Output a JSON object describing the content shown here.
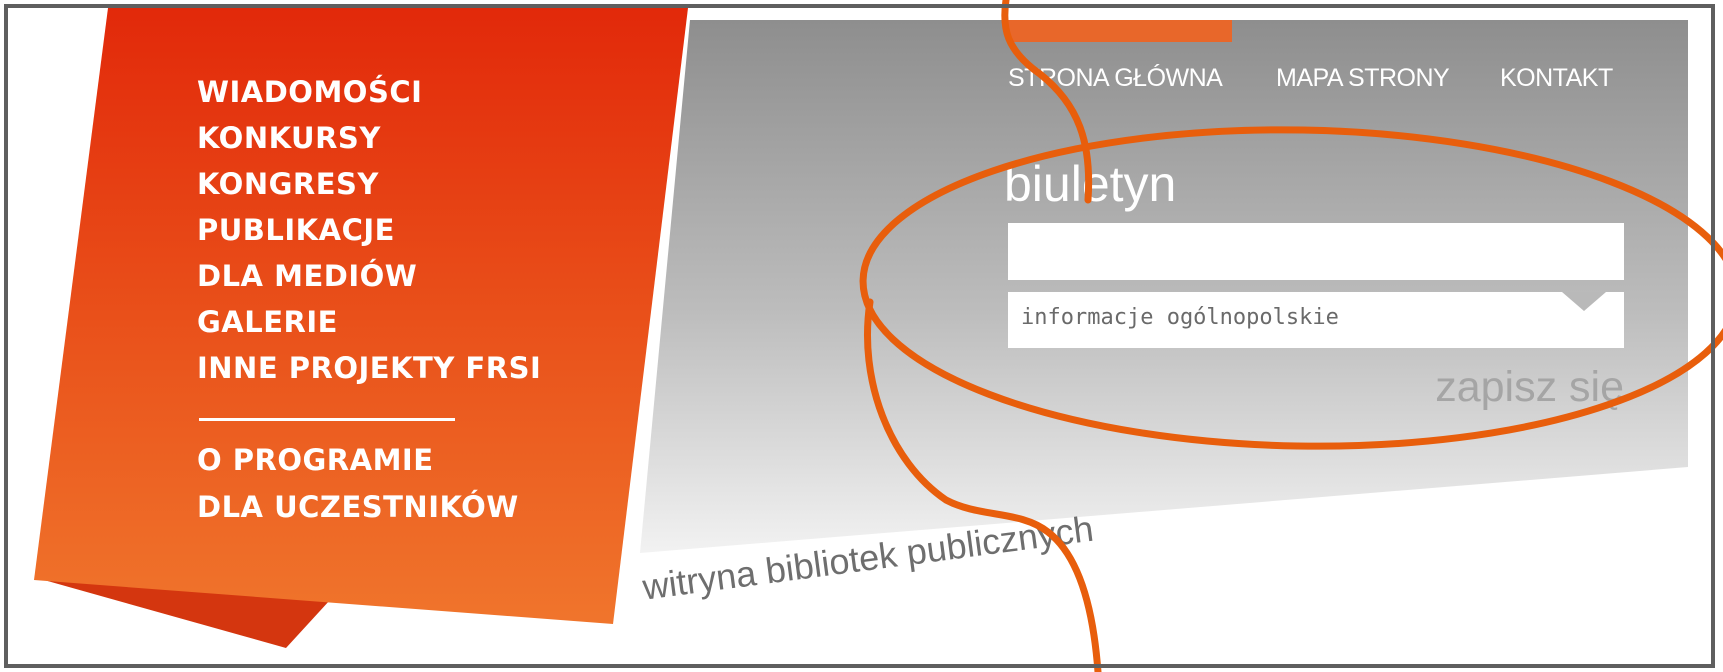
{
  "colors": {
    "brand_orange": "#e8672a",
    "brand_red": "#e3320c",
    "panel_gray": "#9c9c9c",
    "annotation_orange": "#e85e0c",
    "frame_gray": "#5f5f5f"
  },
  "sidebar": {
    "items": [
      {
        "label": "WIADOMOŚCI"
      },
      {
        "label": "KONKURSY"
      },
      {
        "label": "KONGRESY"
      },
      {
        "label": "PUBLIKACJE"
      },
      {
        "label": "DLA MEDIÓW"
      },
      {
        "label": "GALERIE"
      },
      {
        "label": "INNE PROJEKTY FRSI"
      }
    ],
    "secondary_items": [
      {
        "label": "O PROGRAMIE"
      },
      {
        "label": "DLA UCZESTNIKÓW"
      }
    ]
  },
  "header": {
    "links": [
      {
        "label": "STRONA GŁÓWNA"
      },
      {
        "label": "MAPA STRONY"
      },
      {
        "label": "KONTAKT"
      }
    ]
  },
  "newsletter": {
    "title": "biuletyn",
    "email_value": "",
    "list_selected": "informacje ogólnopolskie",
    "submit_label": "zapisz się"
  },
  "tagline": "witryna bibliotek publicznych"
}
